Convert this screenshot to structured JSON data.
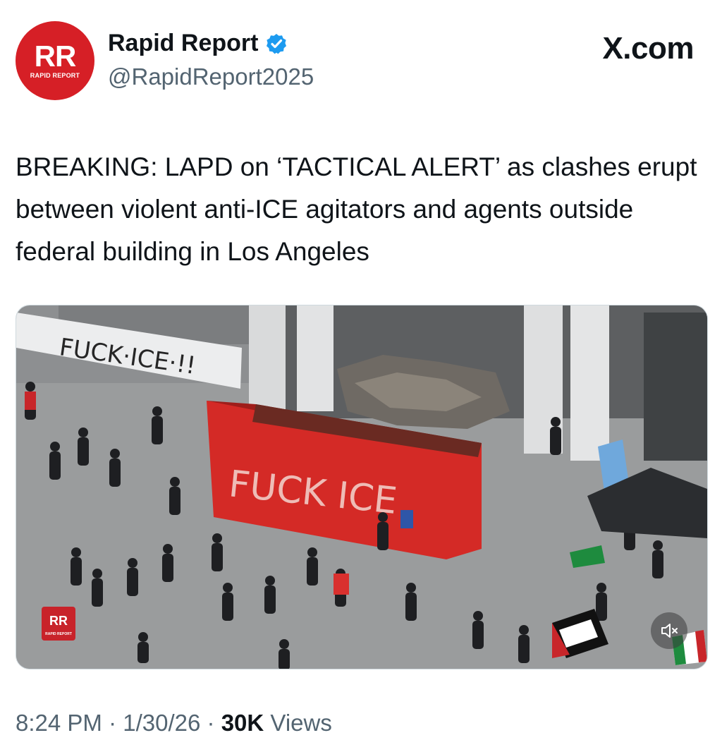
{
  "account": {
    "avatar_initials": "RR",
    "avatar_subtitle": "RAPID REPORT",
    "display_name": "Rapid Report",
    "handle": "@RapidReport2025",
    "verified": true
  },
  "site_label": "X.com",
  "tweet": {
    "text": "BREAKING: LAPD on ‘TACTICAL ALERT’ as clashes erupt between violent anti-ICE agitators and agents outside federal building in Los Angeles"
  },
  "media": {
    "watermark_initials": "RR",
    "watermark_subtitle": "RAPID REPORT",
    "banner_text": "FUCK·ICE·!!",
    "dumpster_text": "FUCK ICE",
    "muted": true
  },
  "meta": {
    "time": "8:24 PM",
    "separator": "·",
    "date": "1/30/26",
    "views_count": "30K",
    "views_label": "Views"
  },
  "colors": {
    "brand_red": "#d61f26",
    "verified_blue": "#1d9bf0",
    "secondary_text": "#536471"
  }
}
